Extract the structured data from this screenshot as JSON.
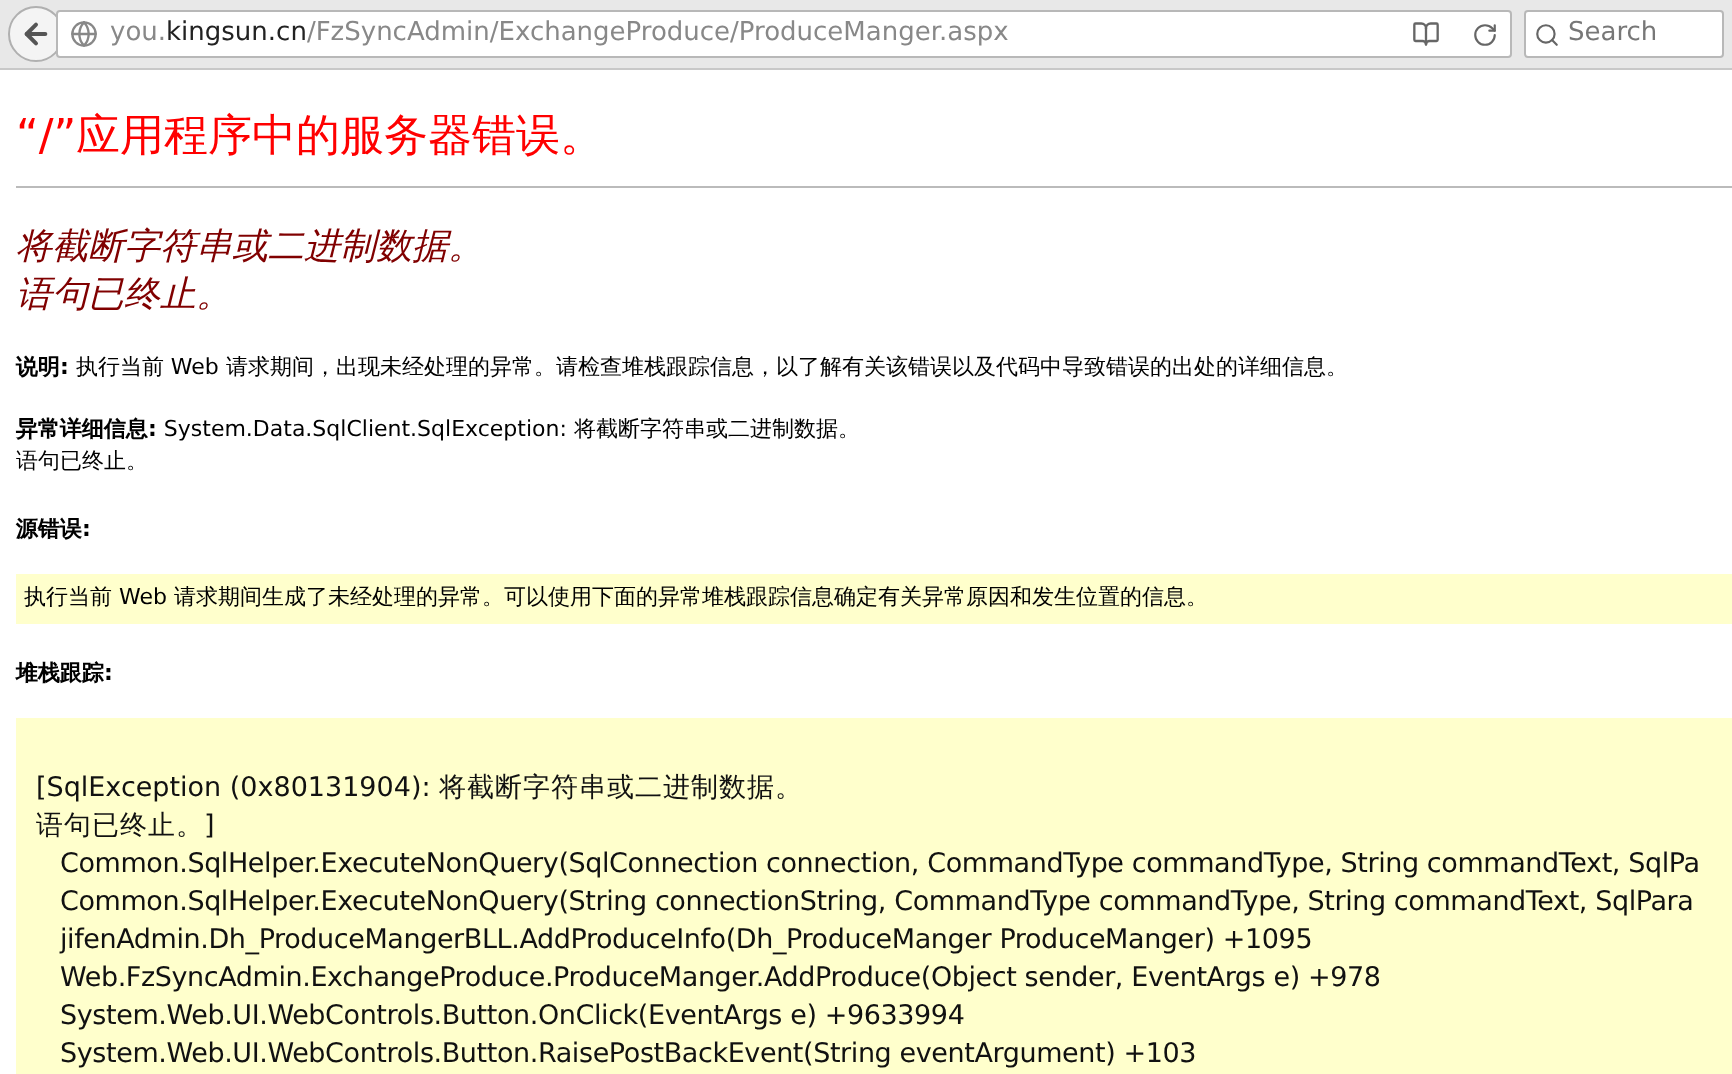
{
  "browser": {
    "url_host_prefix": "you.",
    "url_domain": "kingsun.cn",
    "url_path": "/FzSyncAdmin/ExchangeProduce/ProduceManger.aspx",
    "search_placeholder": "Search"
  },
  "page": {
    "title": "“/”应用程序中的服务器错误。",
    "error_heading": [
      "将截断字符串或二进制数据。",
      "语句已终止。"
    ],
    "description": {
      "label": "说明:",
      "text": "执行当前 Web 请求期间，出现未经处理的异常。请检查堆栈跟踪信息，以了解有关该错误以及代码中导致错误的出处的详细信息。"
    },
    "exception_details": {
      "label": "异常详细信息:",
      "text": "System.Data.SqlClient.SqlException: 将截断字符串或二进制数据。",
      "text_line_2": "语句已终止。"
    },
    "source_error": {
      "label": "源错误:",
      "message": "执行当前 Web 请求期间生成了未经处理的异常。可以使用下面的异常堆栈跟踪信息确定有关异常原因和发生位置的信息。"
    },
    "stack_trace": {
      "label": "堆栈跟踪:",
      "header_lines": [
        "[SqlException (0x80131904): 将截断字符串或二进制数据。",
        "语句已终止。]"
      ],
      "frames": [
        "Common.SqlHelper.ExecuteNonQuery(SqlConnection connection, CommandType commandType, String commandText, SqlPa",
        "Common.SqlHelper.ExecuteNonQuery(String connectionString, CommandType commandType, String commandText, SqlPara",
        "jifenAdmin.Dh_ProduceMangerBLL.AddProduceInfo(Dh_ProduceManger ProduceManger) +1095",
        "Web.FzSyncAdmin.ExchangeProduce.ProduceManger.AddProduce(Object sender, EventArgs e) +978",
        "System.Web.UI.WebControls.Button.OnClick(EventArgs e) +9633994",
        "System.Web.UI.WebControls.Button.RaisePostBackEvent(String eventArgument) +103"
      ]
    }
  }
}
